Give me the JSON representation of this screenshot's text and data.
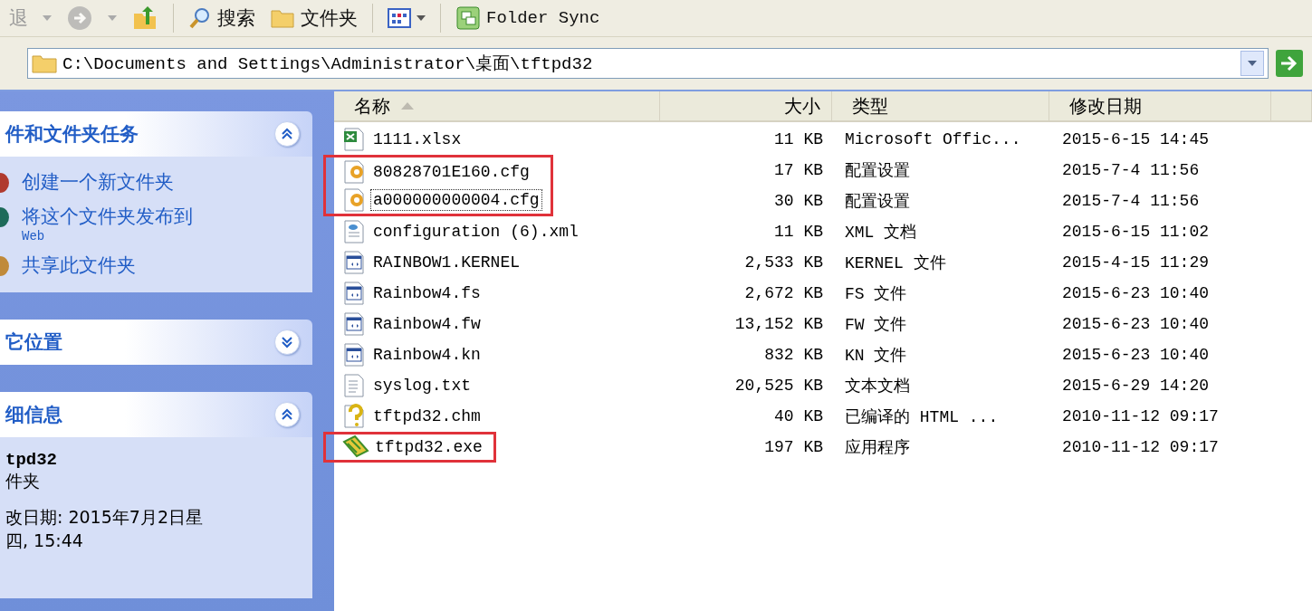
{
  "toolbar": {
    "items": [
      {
        "kind": "text",
        "label": "退",
        "disabled": true
      },
      {
        "kind": "caret",
        "disabled": true
      },
      {
        "kind": "forward",
        "disabled": true
      },
      {
        "kind": "caret",
        "disabled": true
      },
      {
        "kind": "up",
        "disabled": false
      },
      {
        "kind": "sep"
      },
      {
        "kind": "search",
        "label": "搜索",
        "disabled": false
      },
      {
        "kind": "folders",
        "label": "文件夹",
        "disabled": false
      },
      {
        "kind": "sep"
      },
      {
        "kind": "views",
        "disabled": false
      },
      {
        "kind": "sep"
      },
      {
        "kind": "sync",
        "label": "Folder Sync",
        "disabled": false
      }
    ]
  },
  "address": {
    "value": "C:\\Documents and Settings\\Administrator\\桌面\\tftpd32"
  },
  "sidebar": {
    "groups": [
      {
        "title": "件和文件夹任务",
        "expanded": true,
        "kind": "tasks",
        "items": [
          {
            "label": "创建一个新文件夹",
            "color": "#b03a2e"
          },
          {
            "label": "将这个文件夹发布到",
            "sub": "Web",
            "color": "#1e6b5a"
          },
          {
            "label": "共享此文件夹",
            "color": "#c08a3a"
          }
        ]
      },
      {
        "title": "它位置",
        "expanded": false
      },
      {
        "title": "细信息",
        "expanded": true,
        "kind": "details",
        "name": "tpd32",
        "type": "件夹",
        "lines": [
          "改日期: 2015年7月2日星",
          "四, 15:44"
        ]
      }
    ]
  },
  "table": {
    "columns": [
      {
        "label": "名称",
        "sorted": true
      },
      {
        "label": "大小",
        "sorted": false
      },
      {
        "label": "类型",
        "sorted": false
      },
      {
        "label": "修改日期",
        "sorted": false
      }
    ],
    "rows": [
      {
        "kind": "excel",
        "name": "1111.xlsx",
        "size": "11 KB",
        "type": "Microsoft Offic...",
        "date": "2015-6-15 14:45",
        "marked": false,
        "focused": false
      },
      {
        "kind": "cfg",
        "name": "80828701E160.cfg",
        "size": "17 KB",
        "type": "配置设置",
        "date": "2015-7-4 11:56",
        "marked": true,
        "focused": false
      },
      {
        "kind": "cfg",
        "name": "a000000000004.cfg",
        "size": "30 KB",
        "type": "配置设置",
        "date": "2015-7-4 11:56",
        "marked": true,
        "focused": true
      },
      {
        "kind": "xml",
        "name": "configuration (6).xml",
        "size": "11 KB",
        "type": "XML 文档",
        "date": "2015-6-15 11:02",
        "marked": false,
        "focused": false
      },
      {
        "kind": "app",
        "name": "RAINBOW1.KERNEL",
        "size": "2,533 KB",
        "type": "KERNEL 文件",
        "date": "2015-4-15 11:29",
        "marked": false,
        "focused": false
      },
      {
        "kind": "app",
        "name": "Rainbow4.fs",
        "size": "2,672 KB",
        "type": "FS 文件",
        "date": "2015-6-23 10:40",
        "marked": false,
        "focused": false
      },
      {
        "kind": "app",
        "name": "Rainbow4.fw",
        "size": "13,152 KB",
        "type": "FW 文件",
        "date": "2015-6-23 10:40",
        "marked": false,
        "focused": false
      },
      {
        "kind": "app",
        "name": "Rainbow4.kn",
        "size": "832 KB",
        "type": "KN 文件",
        "date": "2015-6-23 10:40",
        "marked": false,
        "focused": false
      },
      {
        "kind": "txt",
        "name": "syslog.txt",
        "size": "20,525 KB",
        "type": "文本文档",
        "date": "2015-6-29 14:20",
        "marked": false,
        "focused": false
      },
      {
        "kind": "chm",
        "name": "tftpd32.chm",
        "size": "40 KB",
        "type": "已编译的 HTML ...",
        "date": "2010-11-12 09:17",
        "marked": false,
        "focused": false
      },
      {
        "kind": "exe",
        "name": "tftpd32.exe",
        "size": "197 KB",
        "type": "应用程序",
        "date": "2010-11-12 09:17",
        "marked": true,
        "focused": false
      }
    ]
  }
}
